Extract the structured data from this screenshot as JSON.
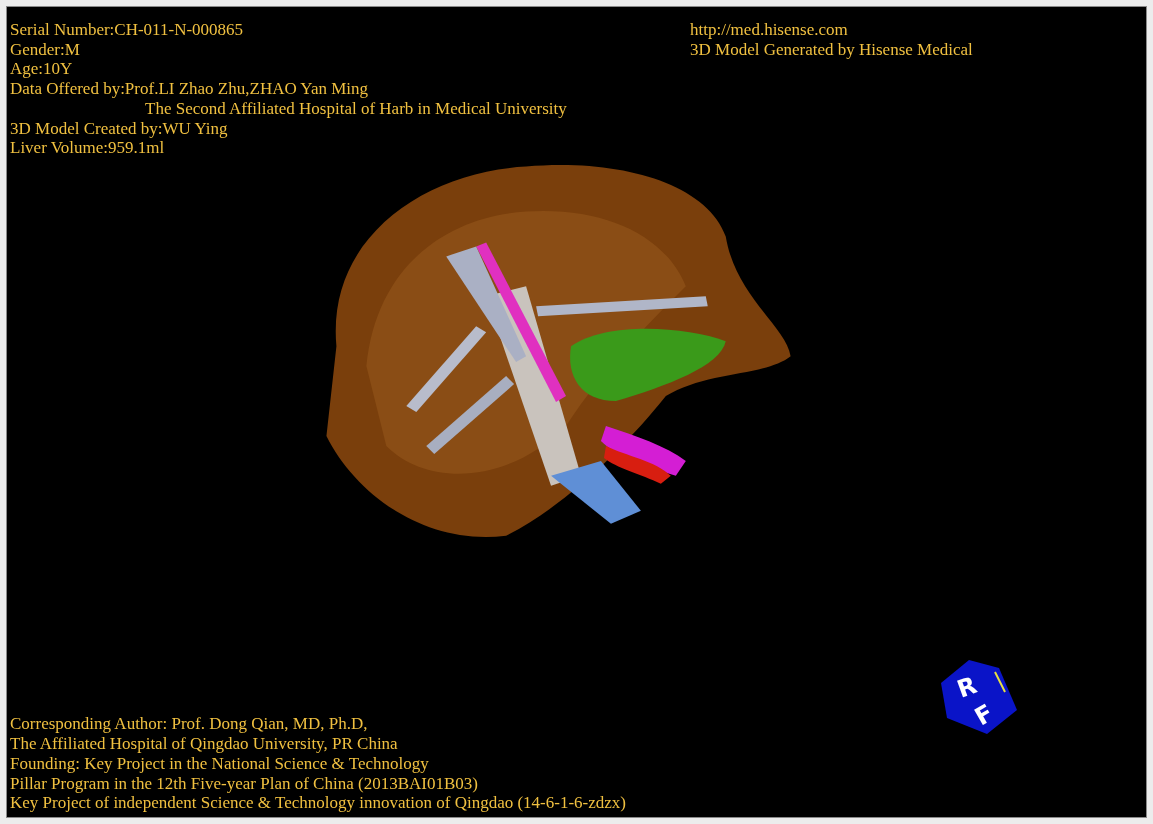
{
  "info_left": [
    {
      "text": "Serial Number:CH-011-N-000865",
      "kind": "line"
    },
    {
      "text": "Gender:M",
      "kind": "line"
    },
    {
      "text": "Age:10Y",
      "kind": "line"
    },
    {
      "text": "Data Offered by:Prof.LI Zhao Zhu,ZHAO Yan Ming",
      "kind": "line"
    },
    {
      "text": "The Second Affiliated Hospital of Harb in Medical University",
      "kind": "continuation"
    },
    {
      "text": "3D Model Created by:WU Ying",
      "kind": "line"
    },
    {
      "text": "Liver Volume:959.1ml",
      "kind": "line"
    }
  ],
  "info_right": [
    "http://med.hisense.com",
    "3D Model Generated by Hisense Medical"
  ],
  "orientation_cube": {
    "labels": [
      "R",
      "F"
    ]
  },
  "credits": [
    "Corresponding Author: Prof. Dong Qian, MD, Ph.D,",
    "The Affiliated Hospital of Qingdao University, PR China",
    "Founding: Key Project in the National Science & Technology",
    "Pillar Program in the 12th Five-year Plan of China (2013BAI01B03)",
    "Key Project of independent Science & Technology innovation of Qingdao (14-6-1-6-zdzx)"
  ]
}
